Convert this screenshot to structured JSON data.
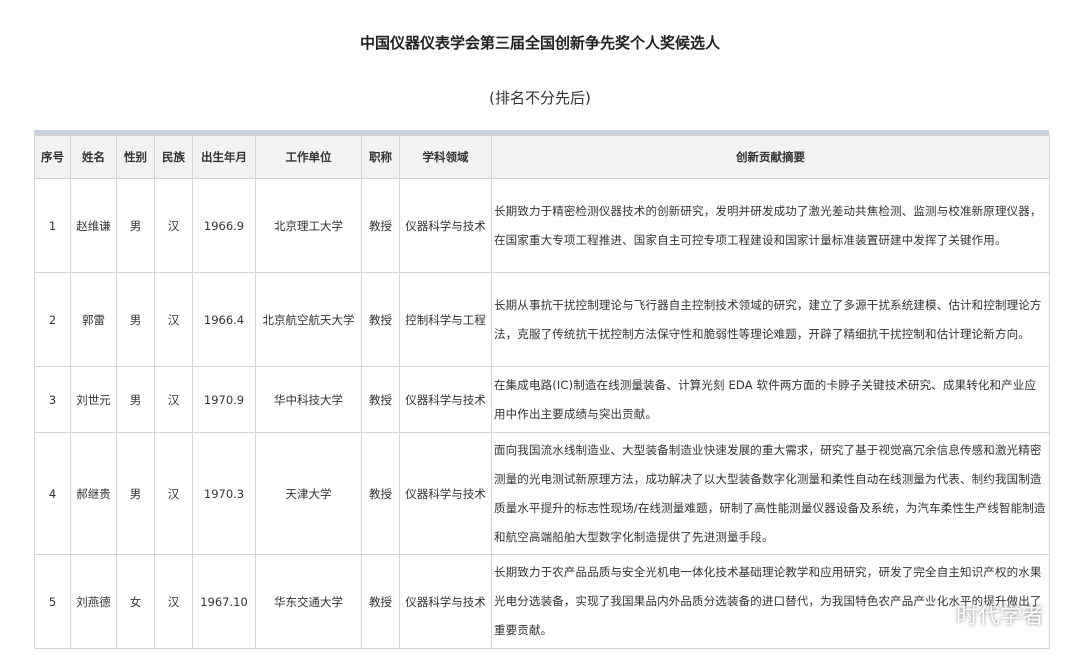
{
  "page": {
    "title": "中国仪器仪表学会第三届全国创新争先奖个人奖候选人",
    "subtitle": "(排名不分先后)"
  },
  "table": {
    "headers": [
      "序号",
      "姓名",
      "性别",
      "民族",
      "出生年月",
      "工作单位",
      "职称",
      "学科领域",
      "创新贡献摘要"
    ],
    "rows": [
      [
        "1",
        "赵维谦",
        "男",
        "汉",
        "1966.9",
        "北京理工大学",
        "教授",
        "仪器科学与技术",
        "长期致力于精密检测仪器技术的创新研究，发明并研发成功了激光差动共焦检测、监测与校准新原理仪器，在国家重大专项工程推进、国家自主可控专项工程建设和国家计量标准装置研建中发挥了关键作用。"
      ],
      [
        "2",
        "郭雷",
        "男",
        "汉",
        "1966.4",
        "北京航空航天大学",
        "教授",
        "控制科学与工程",
        "长期从事抗干扰控制理论与飞行器自主控制技术领域的研究，建立了多源干扰系统建模、估计和控制理论方法，克服了传统抗干扰控制方法保守性和脆弱性等理论难题，开辟了精细抗干扰控制和估计理论新方向。"
      ],
      [
        "3",
        "刘世元",
        "男",
        "汉",
        "1970.9",
        "华中科技大学",
        "教授",
        "仪器科学与技术",
        "在集成电路(IC)制造在线测量装备、计算光刻 EDA 软件两方面的卡脖子关键技术研究、成果转化和产业应用中作出主要成绩与突出贡献。"
      ],
      [
        "4",
        "郝继贵",
        "男",
        "汉",
        "1970.3",
        "天津大学",
        "教授",
        "仪器科学与技术",
        "面向我国流水线制造业、大型装备制造业快速发展的重大需求，研究了基于视觉高冗余信息传感和激光精密测量的光电测试新原理方法，成功解决了以大型装备数字化测量和柔性自动在线测量为代表、制约我国制造质量水平提升的标志性现场/在线测量难题，研制了高性能测量仪器设备及系统，为汽车柔性生产线智能制造和航空高端船舶大型数字化制造提供了先进测量手段。"
      ],
      [
        "5",
        "刘燕德",
        "女",
        "汉",
        "1967.10",
        "华东交通大学",
        "教授",
        "仪器科学与技术",
        "长期致力于农产品品质与安全光机电一体化技术基础理论教学和应用研究，研发了完全自主知识产权的水果光电分选装备，实现了我国果品内外品质分选装备的进口替代，为我国特色农产品产业化水平的提升做出了重要贡献。"
      ]
    ]
  },
  "watermark": {
    "text": "时代学者",
    "icon": "wechat-icon"
  }
}
